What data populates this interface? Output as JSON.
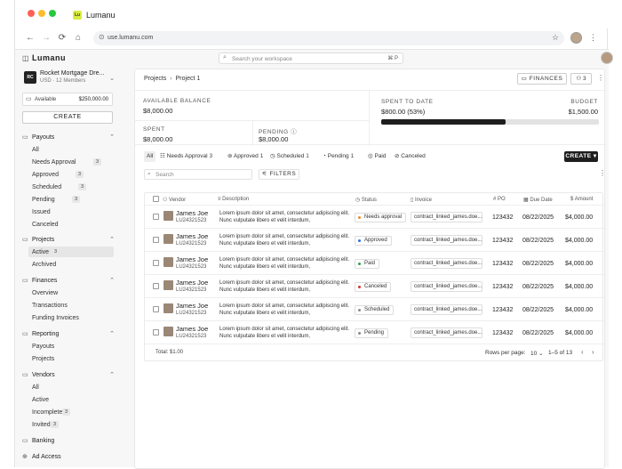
{
  "browser": {
    "tab_title": "Lumanu",
    "favicon_text": "Lu",
    "url": "use.lumanu.com"
  },
  "sidebar": {
    "brand": "Lumanu",
    "org": {
      "logo": "RC",
      "name": "Rocket Mortgage Dre...",
      "sub": "USD · 12 Members"
    },
    "available_label": "Available",
    "available_value": "$250,000.00",
    "create_label": "CREATE",
    "sections": {
      "payouts": {
        "label": "Payouts",
        "items": [
          {
            "label": "All"
          },
          {
            "label": "Needs Approval",
            "badge": "3"
          },
          {
            "label": "Approved",
            "badge": "3"
          },
          {
            "label": "Scheduled",
            "badge": "3"
          },
          {
            "label": "Pending",
            "badge": "3"
          },
          {
            "label": "Issued"
          },
          {
            "label": "Canceled"
          }
        ]
      },
      "projects": {
        "label": "Projects",
        "items": [
          {
            "label": "Active",
            "badge": "3"
          },
          {
            "label": "Archived"
          }
        ]
      },
      "finances": {
        "label": "Finances",
        "items": [
          {
            "label": "Overview"
          },
          {
            "label": "Transactions"
          },
          {
            "label": "Funding Invoices"
          }
        ]
      },
      "reporting": {
        "label": "Reporting",
        "items": [
          {
            "label": "Payouts"
          },
          {
            "label": "Projects"
          }
        ]
      },
      "vendors": {
        "label": "Vendors",
        "items": [
          {
            "label": "All"
          },
          {
            "label": "Active"
          },
          {
            "label": "Incomplete",
            "badge": "3"
          },
          {
            "label": "Invited",
            "badge": "3"
          }
        ]
      },
      "banking": {
        "label": "Banking"
      },
      "ad_access": {
        "label": "Ad Access"
      }
    }
  },
  "topbar": {
    "search_placeholder": "Search your workspace",
    "search_shortcut": "⌘ P"
  },
  "page": {
    "breadcrumb": [
      "Projects",
      "Project 1"
    ],
    "finances_button": "FINANCES",
    "members_count": "3",
    "stats": {
      "available_balance_label": "AVAILABLE BALANCE",
      "available_balance": "$8,000.00",
      "spent_label": "SPENT",
      "spent": "$8,000.00",
      "pending_label": "PENDING",
      "pending": "$8,000.00",
      "spent_to_date_label": "SPENT TO DATE",
      "spent_to_date": "$800.00 (53%)",
      "budget_label": "BUDGET",
      "budget": "$1,500.00",
      "progress_fraction": 0.57
    },
    "tabs": [
      {
        "label": "All"
      },
      {
        "label": "Needs Approval",
        "badge": "3"
      },
      {
        "label": "Approved",
        "badge": "1"
      },
      {
        "label": "Scheduled",
        "badge": "1"
      },
      {
        "label": "Pending",
        "badge": "1"
      },
      {
        "label": "Paid"
      },
      {
        "label": "Canceled"
      }
    ],
    "create_button": "CREATE",
    "table_search_placeholder": "Search",
    "filters_button": "FILTERS",
    "columns": [
      "Vendor",
      "Description",
      "Status",
      "Invoice",
      "PO",
      "Due Date",
      "Amount"
    ],
    "rows": [
      {
        "name": "James Joe",
        "id": "LU24321523",
        "desc": "Lorem ipsum dolor sit amet, consectetur adipiscing elit. Nunc vulputate libero et velit interdum,",
        "status": "Needs approval",
        "status_color": "#f08a24",
        "invoice": "contract_linked_james.doe...",
        "po": "123432",
        "due": "08/22/2025",
        "amount": "$4,000.00"
      },
      {
        "name": "James Joe",
        "id": "LU24321523",
        "desc": "Lorem ipsum dolor sit amet, consectetur adipiscing elit. Nunc vulputate libero et velit interdum,",
        "status": "Approved",
        "status_color": "#2f6fe0",
        "invoice": "contract_linked_james.doe...",
        "po": "123432",
        "due": "08/22/2025",
        "amount": "$4,000.00"
      },
      {
        "name": "James Joe",
        "id": "LU24321523",
        "desc": "Lorem ipsum dolor sit amet, consectetur adipiscing elit. Nunc vulputate libero et velit interdum,",
        "status": "Paid",
        "status_color": "#2e9e4f",
        "invoice": "contract_linked_james.doe...",
        "po": "123432",
        "due": "08/22/2025",
        "amount": "$4,000.00"
      },
      {
        "name": "James Joe",
        "id": "LU24321523",
        "desc": "Lorem ipsum dolor sit amet, consectetur adipiscing elit. Nunc vulputate libero et velit interdum,",
        "status": "Canceled",
        "status_color": "#d9342b",
        "invoice": "contract_linked_james.doe...",
        "po": "123432",
        "due": "08/22/2025",
        "amount": "$4,000.00"
      },
      {
        "name": "James Joe",
        "id": "LU24321523",
        "desc": "Lorem ipsum dolor sit amet, consectetur adipiscing elit. Nunc vulputate libero et velit interdum,",
        "status": "Scheduled",
        "status_color": "#8a8a8a",
        "invoice": "contract_linked_james.doe...",
        "po": "123432",
        "due": "08/22/2025",
        "amount": "$4,000.00"
      },
      {
        "name": "James Joe",
        "id": "LU24321523",
        "desc": "Lorem ipsum dolor sit amet, consectetur adipiscing elit. Nunc vulputate libero et velit interdum,",
        "status": "Pending",
        "status_color": "#8a8a8a",
        "invoice": "contract_linked_james.doe...",
        "po": "123432",
        "due": "08/22/2025",
        "amount": "$4,000.00"
      }
    ],
    "footer": {
      "total": "Total: $1.00",
      "rows_per_page_label": "Rows per page:",
      "rows_per_page": "10",
      "range": "1–5 of 13"
    }
  }
}
